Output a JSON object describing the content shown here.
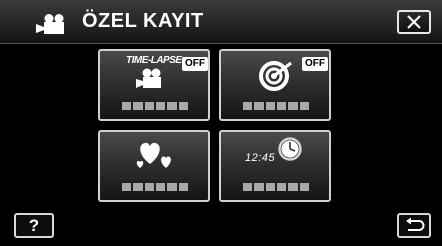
{
  "header": {
    "title": "ÖZEL KAYIT",
    "mode_icon": "video-camera-icon",
    "close_icon": "close-x-icon"
  },
  "tiles": [
    {
      "label": "TIME-LAPSE",
      "badge": "OFF",
      "icon": "time-lapse-camera-icon",
      "mask_segments": 6
    },
    {
      "badge": "OFF",
      "icon": "auto-rec-target-icon",
      "mask_segments": 6
    },
    {
      "icon": "hearts-icon",
      "mask_segments": 6
    },
    {
      "time_text": "12:45",
      "icon": "clock-icon",
      "mask_segments": 6
    }
  ],
  "footer": {
    "help_label": "?",
    "back_icon": "return-arrow-icon"
  },
  "colors": {
    "background": "#000000",
    "text": "#ffffff",
    "mask": "#a8a8a8"
  }
}
